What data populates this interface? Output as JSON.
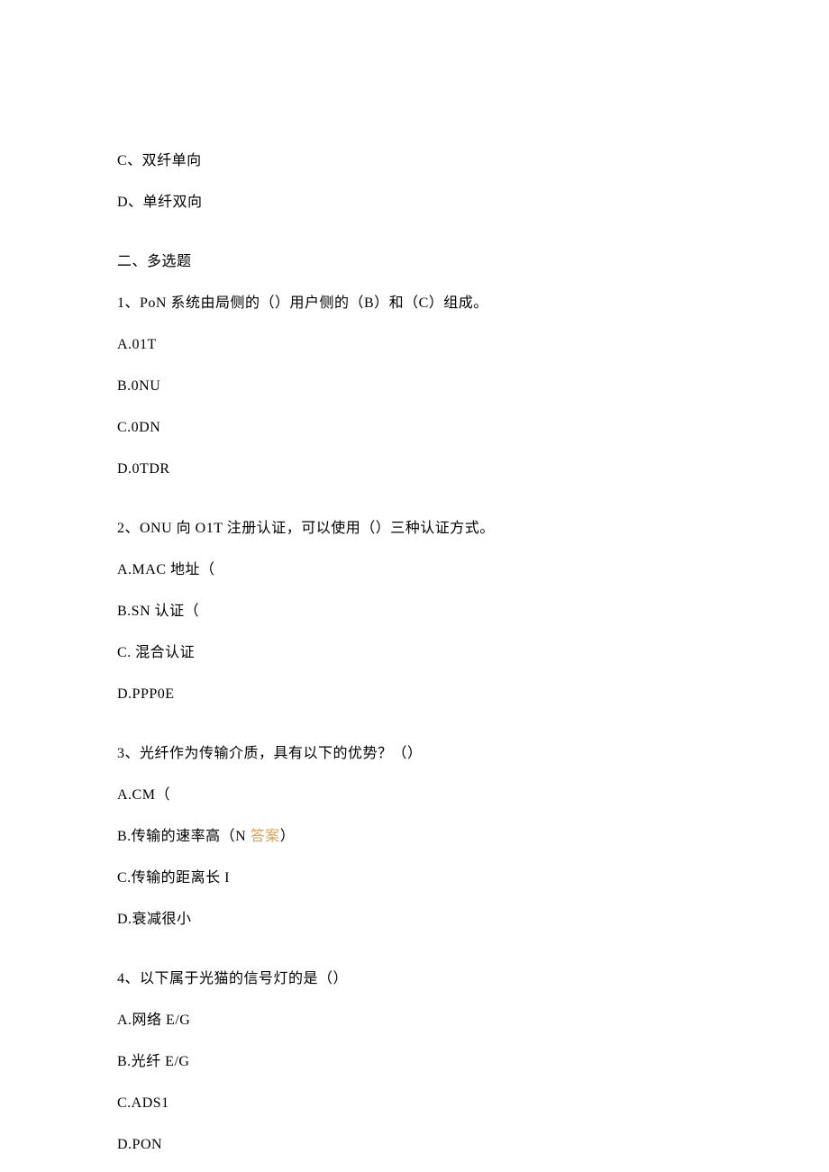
{
  "prev_q_options": {
    "c": "C、双纤单向",
    "d": "D、单纤双向"
  },
  "section2": {
    "heading": "二、多选题",
    "q1": {
      "stem": "1、PoN 系统由局侧的（）用户侧的（B）和（C）组成。",
      "a": "A.01T",
      "b": "B.0NU",
      "c": "C.0DN",
      "d": "D.0TDR"
    },
    "q2": {
      "stem": "2、ONU 向 O1T 注册认证，可以使用（）三种认证方式。",
      "a": "A.MAC 地址（",
      "b": "B.SN 认证（",
      "c": "C. 混合认证",
      "d": "D.PPP0E"
    },
    "q3": {
      "stem": "3、光纤作为传输介质，具有以下的优势？（）",
      "a": "A.CM（",
      "b_prefix": "B.传输的速率高（N ",
      "b_highlight": "答案",
      "b_suffix": "）",
      "c": "C.传输的距离长 I",
      "d": "D.衰减很小"
    },
    "q4": {
      "stem": "4、以下属于光猫的信号灯的是（）",
      "a": "A.网络 E/G",
      "b": "B.光纤 E/G",
      "c": "C.ADS1",
      "d": "D.PON"
    }
  }
}
